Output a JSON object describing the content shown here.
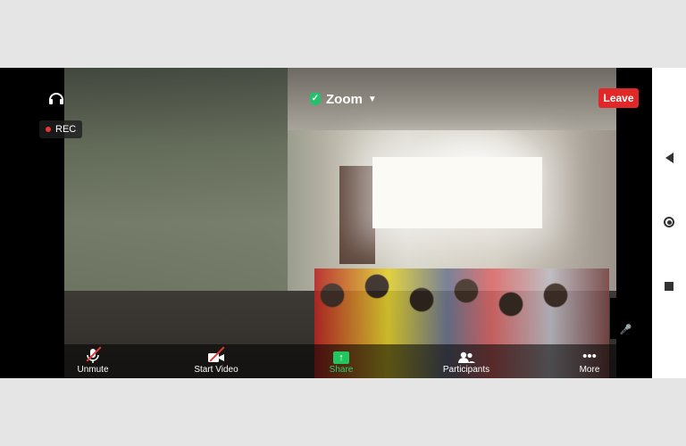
{
  "meeting": {
    "title": "Zoom",
    "recording_label": "REC",
    "leave_label": "Leave"
  },
  "toolbar": {
    "unmute_label": "Unmute",
    "start_video_label": "Start Video",
    "share_label": "Share",
    "participants_label": "Participants",
    "more_label": "More"
  },
  "colors": {
    "leave": "#e02828",
    "share": "#22c55e",
    "secure_shield": "#23c16b"
  },
  "icons": {
    "top_left": "headset-icon",
    "security": "shield-check-icon",
    "title_dropdown": "chevron-down-icon",
    "unmute": "muted-mic-icon",
    "start_video": "video-off-icon",
    "share": "share-screen-icon",
    "participants": "participants-icon",
    "more": "more-dots-icon",
    "nav_back": "back-triangle-icon",
    "nav_home": "home-circle-icon",
    "nav_recents": "recents-square-icon"
  }
}
